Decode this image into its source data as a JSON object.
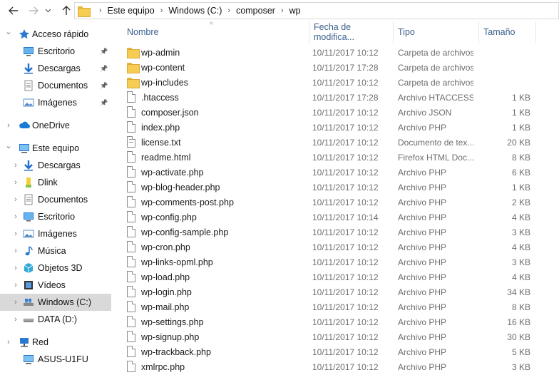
{
  "toolbar": {
    "back_icon": "arrow-left-icon",
    "forward_icon": "arrow-right-icon",
    "recent_icon": "chevron-down-icon",
    "up_icon": "arrow-up-icon"
  },
  "breadcrumb": [
    "Este equipo",
    "Windows (C:)",
    "composer",
    "wp"
  ],
  "nav": {
    "quick_access": "Acceso rápido",
    "quick_items": [
      "Escritorio",
      "Descargas",
      "Documentos",
      "Imágenes"
    ],
    "onedrive": "OneDrive",
    "this_pc": "Este equipo",
    "pc_items": [
      "Descargas",
      "Dlink",
      "Documentos",
      "Escritorio",
      "Imágenes",
      "Música",
      "Objetos 3D",
      "Vídeos",
      "Windows (C:)",
      "DATA (D:)"
    ],
    "network": "Red",
    "network_items": [
      "ASUS-U1FU"
    ]
  },
  "columns": {
    "name": "Nombre",
    "date": "Fecha de modifica...",
    "type": "Tipo",
    "size": "Tamaño"
  },
  "files": [
    {
      "name": "wp-admin",
      "date": "10/11/2017 10:12",
      "type": "Carpeta de archivos",
      "size": "",
      "kind": "folder"
    },
    {
      "name": "wp-content",
      "date": "10/11/2017 17:28",
      "type": "Carpeta de archivos",
      "size": "",
      "kind": "folder"
    },
    {
      "name": "wp-includes",
      "date": "10/11/2017 10:12",
      "type": "Carpeta de archivos",
      "size": "",
      "kind": "folder"
    },
    {
      "name": ".htaccess",
      "date": "10/11/2017 17:28",
      "type": "Archivo HTACCESS",
      "size": "1 KB",
      "kind": "file"
    },
    {
      "name": "composer.json",
      "date": "10/11/2017 10:12",
      "type": "Archivo JSON",
      "size": "1 KB",
      "kind": "file"
    },
    {
      "name": "index.php",
      "date": "10/11/2017 10:12",
      "type": "Archivo PHP",
      "size": "1 KB",
      "kind": "file"
    },
    {
      "name": "license.txt",
      "date": "10/11/2017 10:12",
      "type": "Documento de tex...",
      "size": "20 KB",
      "kind": "text"
    },
    {
      "name": "readme.html",
      "date": "10/11/2017 10:12",
      "type": "Firefox HTML Doc...",
      "size": "8 KB",
      "kind": "file"
    },
    {
      "name": "wp-activate.php",
      "date": "10/11/2017 10:12",
      "type": "Archivo PHP",
      "size": "6 KB",
      "kind": "file"
    },
    {
      "name": "wp-blog-header.php",
      "date": "10/11/2017 10:12",
      "type": "Archivo PHP",
      "size": "1 KB",
      "kind": "file"
    },
    {
      "name": "wp-comments-post.php",
      "date": "10/11/2017 10:12",
      "type": "Archivo PHP",
      "size": "2 KB",
      "kind": "file"
    },
    {
      "name": "wp-config.php",
      "date": "10/11/2017 10:14",
      "type": "Archivo PHP",
      "size": "4 KB",
      "kind": "file"
    },
    {
      "name": "wp-config-sample.php",
      "date": "10/11/2017 10:12",
      "type": "Archivo PHP",
      "size": "3 KB",
      "kind": "file"
    },
    {
      "name": "wp-cron.php",
      "date": "10/11/2017 10:12",
      "type": "Archivo PHP",
      "size": "4 KB",
      "kind": "file"
    },
    {
      "name": "wp-links-opml.php",
      "date": "10/11/2017 10:12",
      "type": "Archivo PHP",
      "size": "3 KB",
      "kind": "file"
    },
    {
      "name": "wp-load.php",
      "date": "10/11/2017 10:12",
      "type": "Archivo PHP",
      "size": "4 KB",
      "kind": "file"
    },
    {
      "name": "wp-login.php",
      "date": "10/11/2017 10:12",
      "type": "Archivo PHP",
      "size": "34 KB",
      "kind": "file"
    },
    {
      "name": "wp-mail.php",
      "date": "10/11/2017 10:12",
      "type": "Archivo PHP",
      "size": "8 KB",
      "kind": "file"
    },
    {
      "name": "wp-settings.php",
      "date": "10/11/2017 10:12",
      "type": "Archivo PHP",
      "size": "16 KB",
      "kind": "file"
    },
    {
      "name": "wp-signup.php",
      "date": "10/11/2017 10:12",
      "type": "Archivo PHP",
      "size": "30 KB",
      "kind": "file"
    },
    {
      "name": "wp-trackback.php",
      "date": "10/11/2017 10:12",
      "type": "Archivo PHP",
      "size": "5 KB",
      "kind": "file"
    },
    {
      "name": "xmlrpc.php",
      "date": "10/11/2017 10:12",
      "type": "Archivo PHP",
      "size": "3 KB",
      "kind": "file"
    }
  ]
}
